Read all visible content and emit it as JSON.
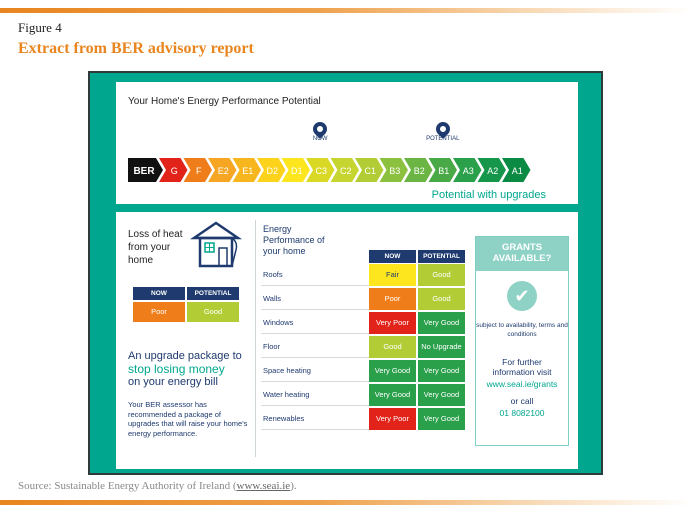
{
  "figure": {
    "label": "Figure 4",
    "title": "Extract from BER advisory report",
    "source_prefix": "Source: Sustainable Energy Authority of Ireland (",
    "source_link": "www.seai.ie",
    "source_suffix": ")."
  },
  "potential_panel": {
    "title": "Your Home's Energy Performance Potential",
    "now_label": "NOW",
    "potential_label": "POTENTIAL",
    "footer": "Potential with upgrades",
    "scale_label": "BER",
    "scale": [
      {
        "label": "G",
        "color": "#e2231a"
      },
      {
        "label": "F",
        "color": "#ef7d1a"
      },
      {
        "label": "E2",
        "color": "#f6a623"
      },
      {
        "label": "E1",
        "color": "#f8b61e"
      },
      {
        "label": "D2",
        "color": "#fcd21b"
      },
      {
        "label": "D1",
        "color": "#fde61e"
      },
      {
        "label": "C3",
        "color": "#d9d925"
      },
      {
        "label": "C2",
        "color": "#c6d52f"
      },
      {
        "label": "C1",
        "color": "#b2cc35"
      },
      {
        "label": "B3",
        "color": "#8cc13f"
      },
      {
        "label": "B2",
        "color": "#6ab544"
      },
      {
        "label": "B1",
        "color": "#4aa947"
      },
      {
        "label": "A3",
        "color": "#2aa04b"
      },
      {
        "label": "A2",
        "color": "#16964a"
      },
      {
        "label": "A1",
        "color": "#0b8a44"
      }
    ],
    "now_rating": "C3",
    "potential_rating": "B1"
  },
  "heat_loss": {
    "label": "Loss of heat from your home",
    "now_header": "NOW",
    "potential_header": "POTENTIAL",
    "now_value": "Poor",
    "potential_value": "Good"
  },
  "upgrade": {
    "heading_line1": "An upgrade package to",
    "heading_line2": "stop losing money",
    "heading_line3": "on your energy bill",
    "body": "Your BER assessor has recommended a package of upgrades that will raise your home's energy performance."
  },
  "performance": {
    "title_line1": "Energy",
    "title_line2": "Performance of",
    "title_line3": "your home",
    "now_header": "NOW",
    "potential_header": "POTENTIAL",
    "rows": [
      {
        "label": "Roofs",
        "now": "Fair",
        "potential": "Good"
      },
      {
        "label": "Walls",
        "now": "Poor",
        "potential": "Good"
      },
      {
        "label": "Windows",
        "now": "Very Poor",
        "potential": "Very Good"
      },
      {
        "label": "Floor",
        "now": "Good",
        "potential": "No Upgrade"
      },
      {
        "label": "Space heating",
        "now": "Very Good",
        "potential": "Very Good"
      },
      {
        "label": "Water heating",
        "now": "Very Good",
        "potential": "Very Good"
      },
      {
        "label": "Renewables",
        "now": "Very Poor",
        "potential": "Very Good"
      }
    ]
  },
  "rating_colors": {
    "Very Poor": "#e2231a",
    "Poor": "#ef7d1a",
    "Fair": "#fde61e",
    "Good": "#b2cc35",
    "Very Good": "#2aa04b",
    "No Upgrade": "#2aa04b"
  },
  "rating_text_colors": {
    "Fair": "#1e3a6e"
  },
  "grants": {
    "heading_line1": "GRANTS",
    "heading_line2": "AVAILABLE?",
    "check_icon": "check-icon",
    "availability": "subject to availability, terms and conditions",
    "info_line1": "For further",
    "info_line2": "information visit",
    "url": "www.seai.ie/grants",
    "or_call": "or call",
    "phone": "01 8082100"
  }
}
